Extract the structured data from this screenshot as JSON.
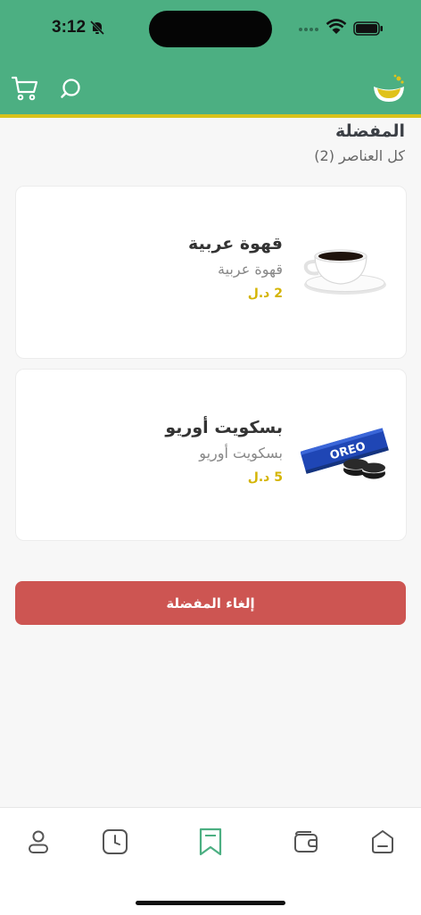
{
  "status_bar": {
    "time": "3:12"
  },
  "header": {
    "cart_icon": "cart-icon",
    "search_icon": "search-icon",
    "logo": "app-logo"
  },
  "page": {
    "title": "المفضلة",
    "subtitle": "كل العناصر (2)"
  },
  "favorites": [
    {
      "name": "قهوة عربية",
      "description": "قهوة عربية",
      "price": "2 د.ل",
      "image": "coffee-cup"
    },
    {
      "name": "بسكويت أوريو",
      "description": "بسكويت أوريو",
      "price": "5 د.ل",
      "image": "oreo-pack",
      "brand_text": "OREO"
    }
  ],
  "actions": {
    "cancel_favorites": "إلغاء المفضلة"
  },
  "bottom_nav": [
    {
      "icon": "profile-icon",
      "active": false
    },
    {
      "icon": "clock-icon",
      "active": false
    },
    {
      "icon": "bookmark-icon",
      "active": true
    },
    {
      "icon": "wallet-icon",
      "active": false
    },
    {
      "icon": "home-icon",
      "active": false
    }
  ],
  "colors": {
    "primary": "#4caf82",
    "accent_line": "#d8c21a",
    "price": "#d4b400",
    "danger": "#cd5552"
  }
}
